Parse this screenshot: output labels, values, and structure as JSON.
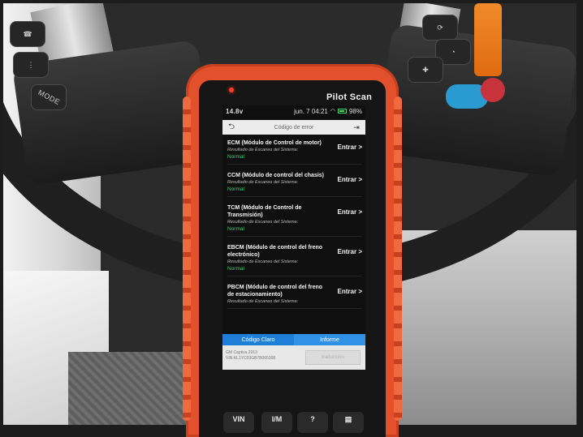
{
  "steering_wheel": {
    "mode_label": "MODE"
  },
  "device": {
    "brand": "Pilot Scan",
    "status_bar": {
      "voltage": "14.8",
      "voltage_unit": "v",
      "date_time": "jun. 7 04:21",
      "battery": "98%"
    },
    "header": {
      "title": "Código de error"
    },
    "modules": [
      {
        "name_lines": [
          "ECM (Módulo de Control de motor)"
        ],
        "result_label": "Resultado de Escaneo del Sistema:",
        "status": "Normal",
        "action": "Entrar >"
      },
      {
        "name_lines": [
          "CCM (Módulo de control del chasis)"
        ],
        "result_label": "Resultado de Escaneo del Sistema:",
        "status": "Normal",
        "action": "Entrar >"
      },
      {
        "name_lines": [
          "TCM (Módulo de Control de",
          "Transmisión)"
        ],
        "result_label": "Resultado de Escaneo del Sistema:",
        "status": "Normal",
        "action": "Entrar >"
      },
      {
        "name_lines": [
          "EBCM (Módulo de control del freno",
          "electrónico)"
        ],
        "result_label": "Resultado de Escaneo del Sistema:",
        "status": "Normal",
        "action": "Entrar >"
      },
      {
        "name_lines": [
          "PBCM (Módulo de control del freno",
          "de estacionamiento)"
        ],
        "result_label": "Resultado de Escaneo del Sistema:",
        "status": "",
        "action": "Entrar >"
      }
    ],
    "tabs": {
      "clear_code": "Código Claro",
      "report": "Informe"
    },
    "vehicle": {
      "model": "GM Captiva 2013",
      "vin": "VIN:KL1YC03GB7B065308"
    },
    "translate_button": "traducción",
    "hardware_buttons": {
      "vin": "VIN",
      "im": "I/M"
    },
    "colors": {
      "accent_blue": "#1f7fd8",
      "status_green": "#39d46a",
      "bumper_orange": "#e2512c"
    }
  }
}
